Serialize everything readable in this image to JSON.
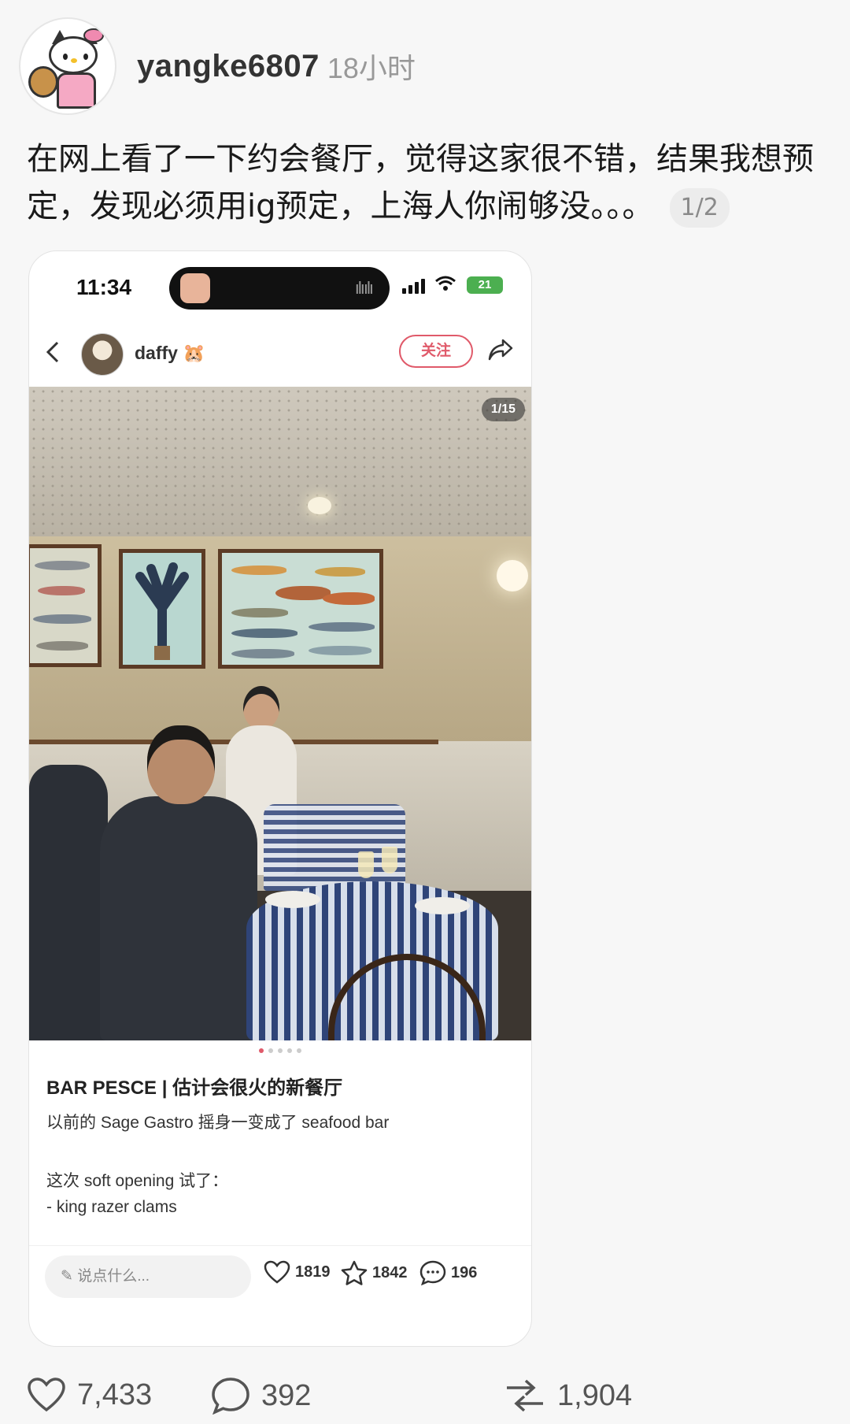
{
  "post": {
    "username": "yangke6807",
    "time": "18小时",
    "text": "在网上看了一下约会餐厅，觉得这家很不错，结果我想预定，发现必须用ig预定，上海人你闹够没。。。",
    "page_badge": "1/2"
  },
  "screenshot": {
    "status": {
      "clock": "11:34",
      "battery": "21"
    },
    "nav": {
      "username": "daffy 🐹",
      "follow_label": "关注"
    },
    "photo_counter": "1/15",
    "note": {
      "title": "BAR PESCE | 估计会很火的新餐厅",
      "line1": "以前的 Sage Gastro 摇身一变成了 seafood bar",
      "line2": "这次 soft opening 试了：",
      "line3": "- king razer clams"
    },
    "bottom": {
      "comment_placeholder": "说点什么...",
      "likes": "1819",
      "favorites": "1842",
      "comments": "196"
    }
  },
  "actions": {
    "likes": "7,433",
    "comments": "392",
    "reposts": "1,904"
  },
  "colors": {
    "accent": "#e05a6a",
    "table_cloth": "#2f4478"
  },
  "icons": [
    "heart-icon",
    "star-icon",
    "comment-icon",
    "share-icon",
    "back-icon",
    "repost-icon",
    "pencil-icon",
    "wifi-icon",
    "signal-icon"
  ]
}
